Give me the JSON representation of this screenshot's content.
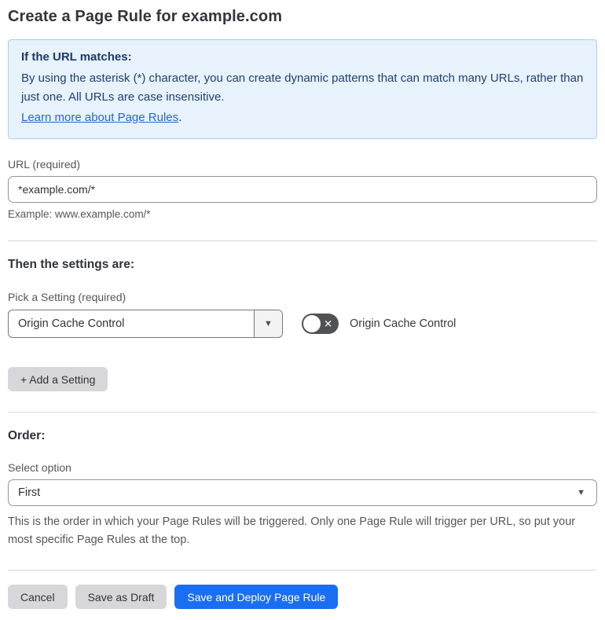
{
  "page": {
    "title": "Create a Page Rule for example.com"
  },
  "info_box": {
    "heading": "If the URL matches:",
    "body": "By using the asterisk (*) character, you can create dynamic patterns that can match many URLs, rather than just one. All URLs are case insensitive.",
    "link": "Learn more about Page Rules",
    "link_suffix": "."
  },
  "url_field": {
    "label": "URL (required)",
    "value": "*example.com/*",
    "helper": "Example: www.example.com/*"
  },
  "settings_section": {
    "heading": "Then the settings are:",
    "picker_label": "Pick a Setting (required)",
    "picker_value": "Origin Cache Control",
    "picker_arrow": "▼",
    "toggle_label": "Origin Cache Control",
    "toggle_state": "off",
    "toggle_off_glyph": "✕",
    "add_button": "+ Add a Setting"
  },
  "order_section": {
    "heading": "Order:",
    "select_label": "Select option",
    "select_value": "First",
    "select_arrow": "▼",
    "helper": "This is the order in which your Page Rules will be triggered. Only one Page Rule will trigger per URL, so put your most specific Page Rules at the top."
  },
  "footer": {
    "cancel": "Cancel",
    "save_draft": "Save as Draft",
    "save_deploy": "Save and Deploy Page Rule"
  },
  "colors": {
    "accent_blue": "#1a6ef2",
    "info_bg": "#e7f2fc",
    "info_border": "#a6cfec",
    "info_text": "#20416f",
    "link_blue": "#2a63d4",
    "toggle_off_bg": "#505255",
    "button_gray": "#d7d7d9"
  }
}
